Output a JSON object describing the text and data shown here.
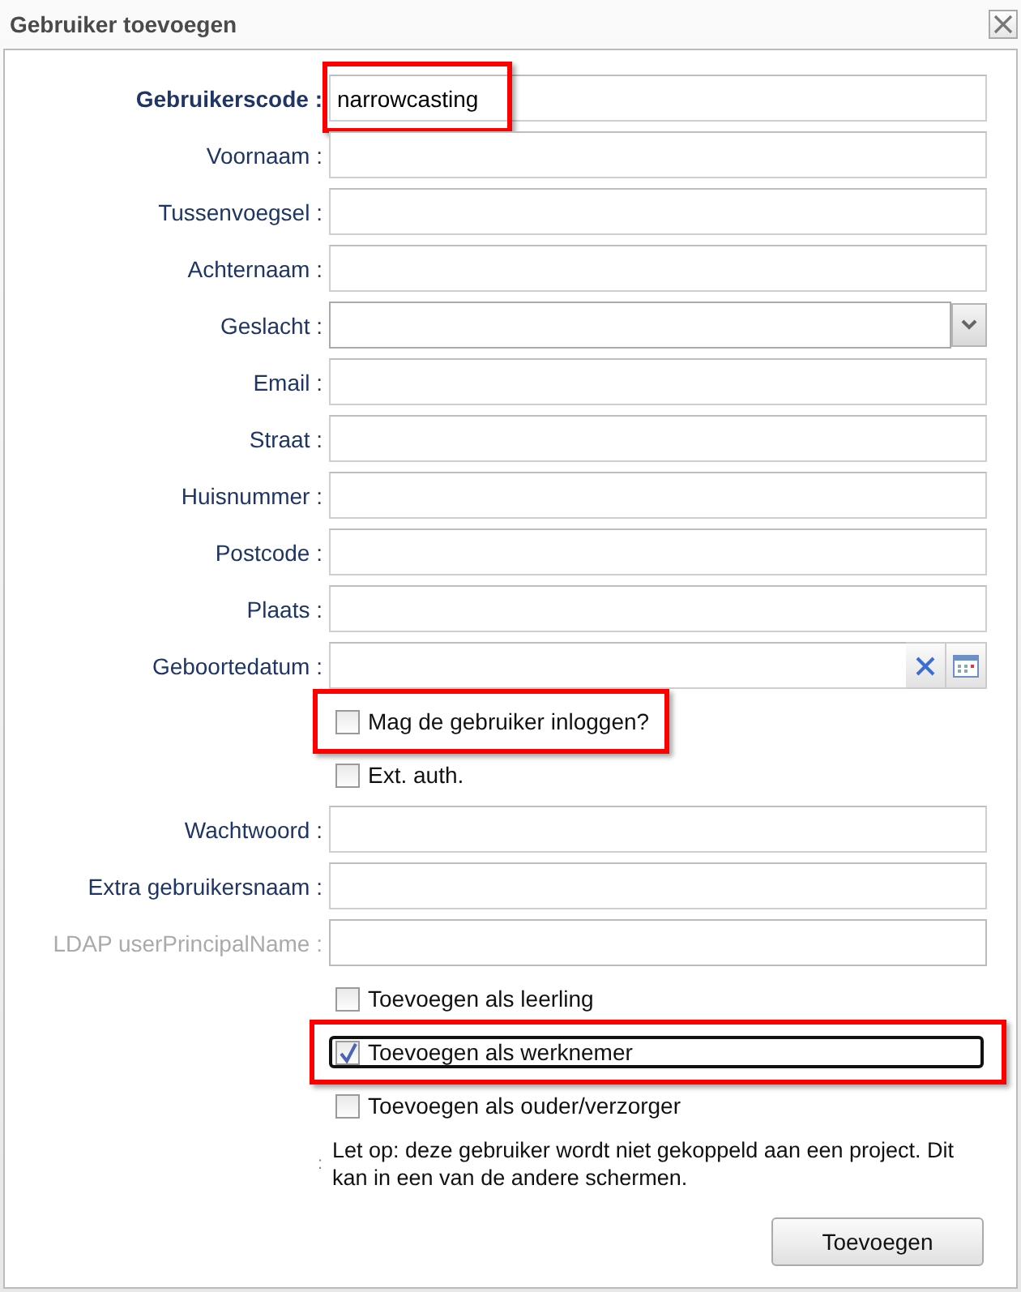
{
  "window": {
    "title": "Gebruiker toevoegen"
  },
  "items": [
    {
      "kind": "text",
      "label": "Gebruikerscode :",
      "required": true,
      "disabled": false,
      "value": "narrowcasting",
      "highlighted": true
    },
    {
      "kind": "text",
      "label": "Voornaam :",
      "required": false,
      "disabled": false,
      "highlighted": false
    },
    {
      "kind": "text",
      "label": "Tussenvoegsel :",
      "required": false,
      "disabled": false,
      "highlighted": false
    },
    {
      "kind": "text",
      "label": "Achternaam :",
      "required": false,
      "disabled": false,
      "highlighted": false
    },
    {
      "kind": "select",
      "label": "Geslacht :",
      "required": false,
      "disabled": false,
      "highlighted": false
    },
    {
      "kind": "text",
      "label": "Email :",
      "required": false,
      "disabled": false,
      "highlighted": false
    },
    {
      "kind": "text",
      "label": "Straat :",
      "required": false,
      "disabled": false,
      "highlighted": false
    },
    {
      "kind": "text",
      "label": "Huisnummer :",
      "required": false,
      "disabled": false,
      "highlighted": false
    },
    {
      "kind": "text",
      "label": "Postcode :",
      "required": false,
      "disabled": false,
      "highlighted": false
    },
    {
      "kind": "text",
      "label": "Plaats :",
      "required": false,
      "disabled": false,
      "highlighted": false
    },
    {
      "kind": "date",
      "label": "Geboortedatum :",
      "required": false,
      "disabled": false,
      "highlighted": false
    },
    {
      "kind": "checkbox",
      "text": "Mag de gebruiker inloggen?",
      "checked": false,
      "focused": false,
      "highlighted": true
    },
    {
      "kind": "checkbox",
      "text": "Ext. auth.",
      "checked": false,
      "focused": false,
      "highlighted": false
    },
    {
      "kind": "text",
      "label": "Wachtwoord :",
      "required": false,
      "disabled": false,
      "highlighted": false
    },
    {
      "kind": "text",
      "label": "Extra gebruikersnaam :",
      "required": false,
      "disabled": false,
      "highlighted": false
    },
    {
      "kind": "text",
      "label": "LDAP userPrincipalName :",
      "required": false,
      "disabled": true,
      "highlighted": false
    },
    {
      "kind": "checkbox",
      "text": "Toevoegen als leerling",
      "checked": false,
      "focused": false,
      "highlighted": false
    },
    {
      "kind": "checkbox",
      "text": "Toevoegen als werknemer",
      "checked": true,
      "focused": true,
      "highlighted": true
    },
    {
      "kind": "checkbox",
      "text": "Toevoegen als ouder/verzorger",
      "checked": false,
      "focused": false,
      "highlighted": false
    },
    {
      "kind": "note",
      "label": ":",
      "text": "Let op: deze gebruiker wordt niet gekoppeld aan een project. Dit kan in een van de andere schermen."
    }
  ],
  "buttons": [
    {
      "label": "Toevoegen"
    }
  ]
}
